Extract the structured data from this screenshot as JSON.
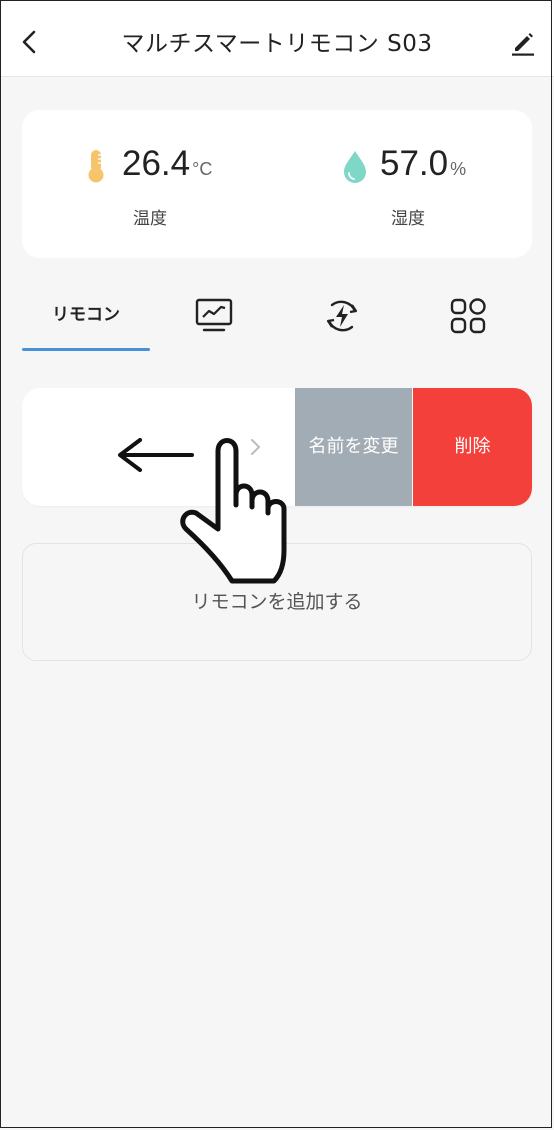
{
  "header": {
    "title": "マルチスマートリモコン S03",
    "back_icon": "chevron-left-icon",
    "edit_icon": "pencil-icon"
  },
  "sensors": {
    "temperature": {
      "value": "26.4",
      "unit": "°C",
      "label": "温度",
      "icon": "thermometer-icon",
      "color": "#f6c56b"
    },
    "humidity": {
      "value": "57.0",
      "unit": "%",
      "label": "湿度",
      "icon": "water-drop-icon",
      "color": "#7fd8c7"
    }
  },
  "tabs": [
    {
      "label": "リモコン",
      "active": true
    },
    {
      "icon": "monitor-chart-icon"
    },
    {
      "icon": "energy-cycle-icon"
    },
    {
      "icon": "grid-apps-icon"
    }
  ],
  "remote_row": {
    "rename_label": "名前を変更",
    "delete_label": "削除",
    "rename_color": "#a2acb4",
    "delete_color": "#f3403a"
  },
  "add_remote_label": "リモコンを追加する",
  "accent_color": "#4a90d9"
}
